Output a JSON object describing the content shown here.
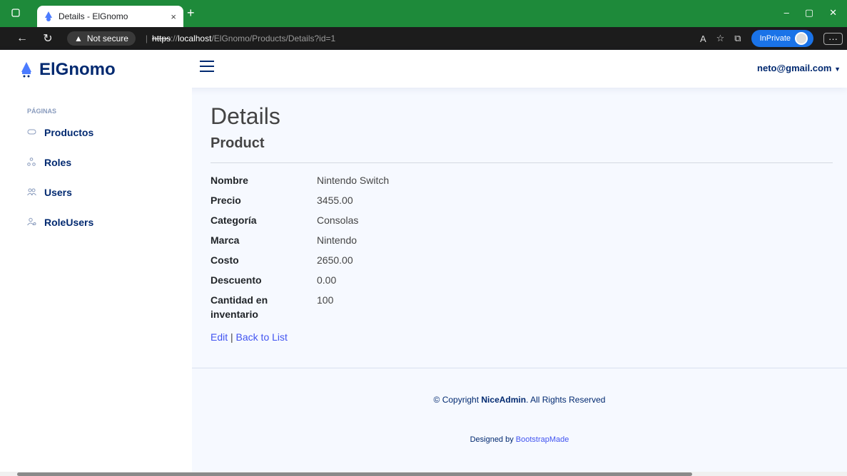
{
  "browser": {
    "tab_title": "Details - ElGnomo",
    "tab_close": "×",
    "new_tab": "+",
    "security_label": "Not secure",
    "url_protocol": "https",
    "url_sep": "://",
    "url_host": "localhost",
    "url_path": "/ElGnomo/Products/Details?id=1",
    "inprivate_label": "InPrivate",
    "more_label": "···",
    "minimize": "–",
    "restore": "▢",
    "close": "✕"
  },
  "header": {
    "brand": "ElGnomo",
    "user_email": "neto@gmail.com"
  },
  "sidebar": {
    "heading": "PÁGINAS",
    "items": [
      {
        "label": "Productos",
        "icon": "gamepad-icon"
      },
      {
        "label": "Roles",
        "icon": "diagram-icon"
      },
      {
        "label": "Users",
        "icon": "people-icon"
      },
      {
        "label": "RoleUsers",
        "icon": "person-gear-icon"
      }
    ]
  },
  "main": {
    "title": "Details",
    "subtitle": "Product",
    "fields": [
      {
        "label": "Nombre",
        "value": "Nintendo Switch"
      },
      {
        "label": "Precio",
        "value": "3455.00"
      },
      {
        "label": "Categoría",
        "value": "Consolas"
      },
      {
        "label": "Marca",
        "value": "Nintendo"
      },
      {
        "label": "Costo",
        "value": "2650.00"
      },
      {
        "label": "Descuento",
        "value": "0.00"
      },
      {
        "label": "Cantidad en inventario",
        "value": "100"
      }
    ],
    "edit_link": "Edit",
    "link_separator": "|",
    "back_link": "Back to List"
  },
  "footer": {
    "copyright_prefix": "© Copyright ",
    "copyright_brand": "NiceAdmin",
    "copyright_suffix": ". All Rights Reserved",
    "designed_prefix": "Designed by ",
    "designed_link": "BootstrapMade"
  },
  "colors": {
    "brand": "#012970",
    "accent": "#4154f1",
    "tabbar": "#1e8a3a"
  }
}
